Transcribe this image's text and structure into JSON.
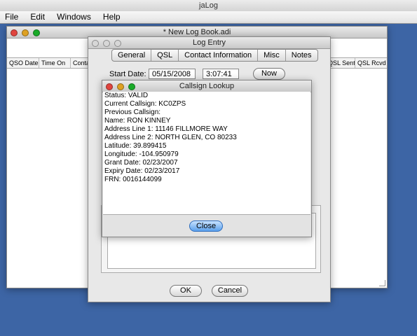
{
  "app": {
    "title": "jaLog"
  },
  "menu": [
    {
      "label": "File"
    },
    {
      "label": "Edit"
    },
    {
      "label": "Windows"
    },
    {
      "label": "Help"
    }
  ],
  "logbook": {
    "title": "* New Log Book.adi",
    "columns": [
      "QSO Date",
      "Time On",
      "Conta",
      "QSL Sent",
      "QSL Rcvd"
    ]
  },
  "log_entry": {
    "title": "Log Entry",
    "tabs": [
      "General",
      "QSL",
      "Contact Information",
      "Misc",
      "Notes"
    ],
    "start_date_label": "Start Date:",
    "start_date_value": "05/15/2008",
    "start_time_value": "3:07:41",
    "now_button": "Now",
    "ok_button": "OK",
    "cancel_button": "Cancel"
  },
  "lookup": {
    "title": "Callsign Lookup",
    "lines": [
      "Status: VALID",
      "Current Callsign: KC0ZPS",
      "Previous Callsign:",
      "Name: RON KINNEY",
      "Address Line 1: 11146 FILLMORE WAY",
      "Address Line 2: NORTH GLEN, CO 80233",
      "Latitude: 39.899415",
      "Longitude: -104.950979",
      "Grant Date: 02/23/2007",
      "Expiry Date: 02/23/2017",
      "FRN: 0016144099"
    ],
    "close_button": "Close"
  }
}
